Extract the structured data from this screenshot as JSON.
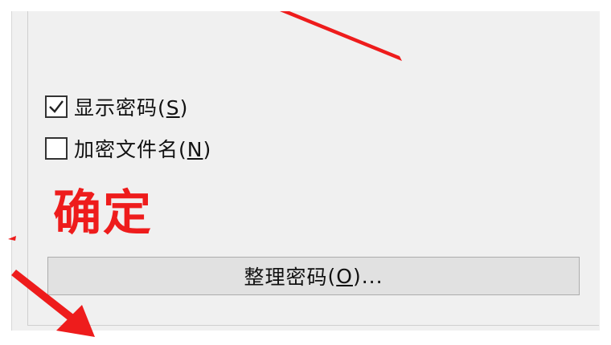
{
  "options": {
    "show_password": {
      "label": "显示密码",
      "open_paren": "(",
      "mnemonic": "S",
      "close_paren": ")",
      "checked": true
    },
    "encrypt_filenames": {
      "label": "加密文件名",
      "open_paren": "(",
      "mnemonic": "N",
      "close_paren": ")",
      "checked": false
    }
  },
  "annotation": {
    "text": "确定",
    "color": "#ee1c1c"
  },
  "organize_button": {
    "label": "整理密码",
    "open_paren": "(",
    "mnemonic": "O",
    "suffix": ")..."
  }
}
